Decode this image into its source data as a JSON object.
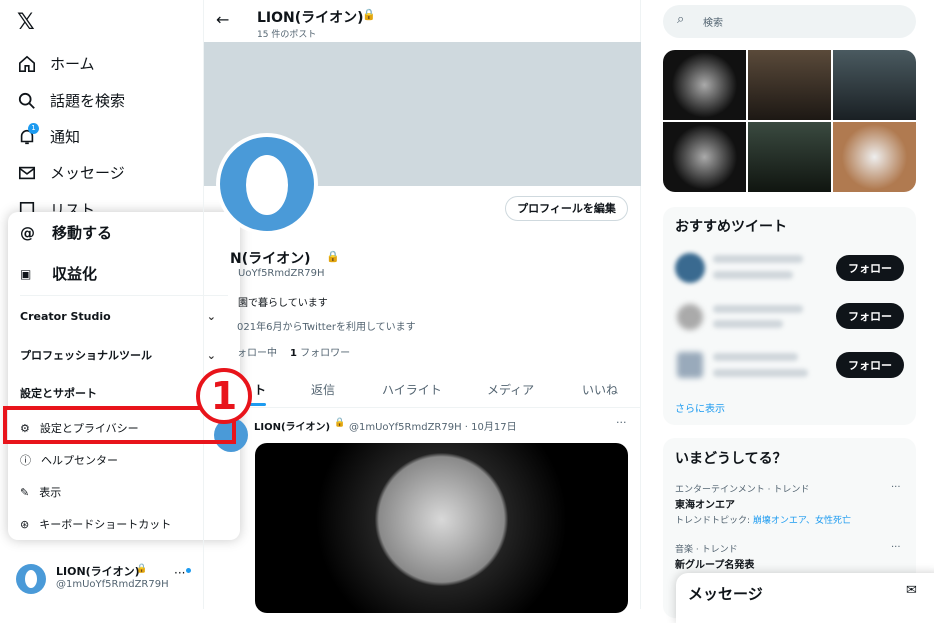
{
  "sidebar": {
    "nav": [
      {
        "label": "ホーム",
        "icon": "home-icon"
      },
      {
        "label": "話題を検索",
        "icon": "search-icon"
      },
      {
        "label": "通知",
        "icon": "bell-icon",
        "badge": "1"
      },
      {
        "label": "メッセージ",
        "icon": "mail-icon"
      },
      {
        "label": "リスト",
        "icon": "list-icon"
      }
    ],
    "account": {
      "name": "LION(ライオン)",
      "handle": "@1mUoYf5RmdZR79H"
    }
  },
  "menu": {
    "items": [
      {
        "label": "移動する",
        "icon": "at-icon"
      },
      {
        "label": "収益化",
        "icon": "money-icon"
      }
    ],
    "creator_studio": "Creator Studio",
    "pro_tools": "プロフェッショナルツール",
    "settings_support": "設定とサポート",
    "sub": [
      {
        "label": "設定とプライバシー",
        "icon": "gear-icon"
      },
      {
        "label": "ヘルプセンター",
        "icon": "help-icon"
      },
      {
        "label": "表示",
        "icon": "display-icon"
      },
      {
        "label": "キーボードショートカット",
        "icon": "keyboard-icon"
      }
    ]
  },
  "annotation": {
    "step": "1",
    "color": "#e8141b"
  },
  "profile": {
    "title": "LION(ライオン)",
    "post_count": "15 件のポスト",
    "edit_button": "プロフィールを編集",
    "name": "N(ライオン)",
    "handle": "UoYf5RmdZR79H",
    "bio": "園で暮らしています",
    "joined": "021年6月からTwitterを利用しています",
    "following": "ォロー中",
    "followers_count": "1",
    "followers": "フォロワー",
    "tabs": [
      "ト",
      "返信",
      "ハイライト",
      "メディア",
      "いいね"
    ],
    "tweet": {
      "name": "LION(ライオン)",
      "meta": "@1mUoYf5RmdZR79H · 10月17日"
    }
  },
  "right": {
    "search_placeholder": "検索",
    "recommend_title": "おすすめツイート",
    "follow_label": "フォロー",
    "show_more": "さらに表示",
    "trends_title": "いまどうしてる？",
    "trends": [
      {
        "category": "エンターテインメント · トレンド",
        "name": "東海オンエア",
        "topic_label": "トレンドトピック: ",
        "topics": "崩壊オンエア、女性死亡"
      },
      {
        "category": "音楽 · トレンド",
        "name": "新グループ名発表"
      }
    ],
    "messages": "メッセージ"
  },
  "colors": {
    "accent": "#1d9bf0",
    "avatar": "#4a9ad8"
  }
}
